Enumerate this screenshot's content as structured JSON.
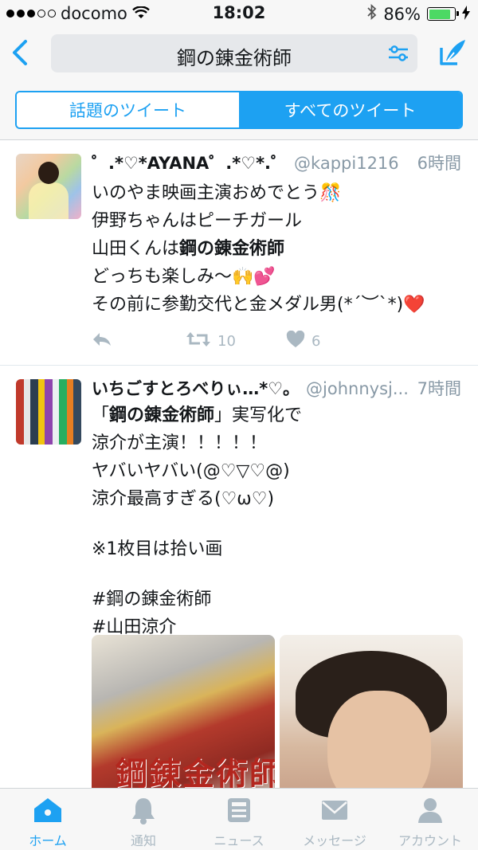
{
  "status_bar": {
    "carrier": "docomo",
    "time": "18:02",
    "battery": "86%",
    "battery_level": 0.86
  },
  "nav": {
    "search_query": "鋼の錬金術師"
  },
  "segments": {
    "top": "話題のツイート",
    "all": "すべてのツイート",
    "selected": "all"
  },
  "tweets": [
    {
      "name": "゜.*♡*AYANA゜.*♡*.゜",
      "handle": "@kappi1216",
      "time": "6時間",
      "lines": {
        "l1": "いのやま映画主演おめでとう🎊",
        "l2": "伊野ちゃんはピーチガール",
        "l3_pre": "山田くんは",
        "l3_bold": "鋼の錬金術師",
        "l4": "どっちも楽しみ〜🙌💕",
        "l5": "その前に参勤交代と金メダル男(*´︶`*)❤️"
      },
      "retweets": "10",
      "likes": "6"
    },
    {
      "name": "いちごすとろべりぃ…*♡。",
      "handle": "@johnnysj...",
      "time": "7時間",
      "lines": {
        "l1_pre": "「",
        "l1_bold": "鋼の錬金術師",
        "l1_post": "」実写化で",
        "l2": "涼介が主演！！！！！",
        "l3": "ヤバいヤバい(@♡▽♡@)",
        "l4": "涼介最高すぎる(♡ω♡)",
        "l5": "※1枚目は拾い画",
        "l6": "#鋼の錬金術師",
        "l7": "#山田涼介"
      },
      "media_title": "鋼錬金術師"
    }
  ],
  "tabbar": [
    {
      "label": "ホーム",
      "icon": "home-icon",
      "active": true
    },
    {
      "label": "通知",
      "icon": "bell-icon",
      "active": false
    },
    {
      "label": "ニュース",
      "icon": "news-icon",
      "active": false
    },
    {
      "label": "メッセージ",
      "icon": "envelope-icon",
      "active": false
    },
    {
      "label": "アカウント",
      "icon": "person-icon",
      "active": false
    }
  ],
  "colors": {
    "accent": "#1da1f2",
    "muted": "#aab8c2",
    "handle": "#8899a6"
  }
}
